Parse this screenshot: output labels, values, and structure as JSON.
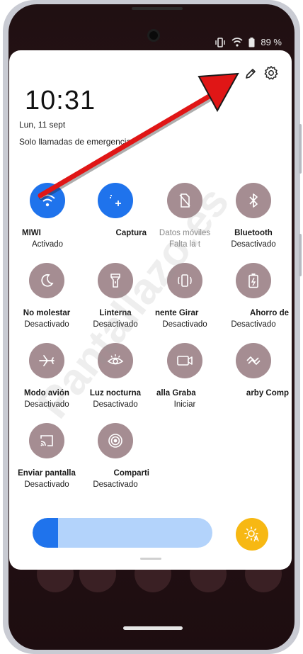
{
  "status_bar": {
    "battery": "89 %"
  },
  "panel": {
    "time": "10:31",
    "date": "Lun, 11 sept",
    "emergency_text": "Solo llamadas de emergencia"
  },
  "tiles": [
    {
      "label": "MIWI",
      "status": "Activado",
      "icon": "wifi-icon",
      "active": true
    },
    {
      "label": "Captura",
      "status": "",
      "icon": "screenshot-icon",
      "active": true
    },
    {
      "label": "Datos móviles",
      "status": "Falta la t",
      "icon": "mobile-data-icon",
      "active": false
    },
    {
      "label": "Bluetooth",
      "status": "Desactivado",
      "icon": "bluetooth-icon",
      "active": false
    },
    {
      "label": "No molestar",
      "status": "Desactivado",
      "icon": "moon-icon",
      "active": false
    },
    {
      "label": "Linterna",
      "status": "Desactivado",
      "icon": "flashlight-icon",
      "active": false
    },
    {
      "label": "nente Girar",
      "status": "Desactivado",
      "icon": "rotate-icon",
      "active": false
    },
    {
      "label": "Ahorro de",
      "status": "Desactivado",
      "icon": "battery-saver-icon",
      "active": false
    },
    {
      "label": "Modo avión",
      "status": "Desactivado",
      "icon": "airplane-icon",
      "active": false
    },
    {
      "label": "Luz nocturna",
      "status": "Desactivado",
      "icon": "eye-icon",
      "active": false
    },
    {
      "label": "alla Graba",
      "status": "Iniciar",
      "icon": "screen-record-icon",
      "active": false
    },
    {
      "label": "arby Comp",
      "status": "",
      "icon": "nearby-share-icon",
      "active": false
    },
    {
      "label": "Enviar pantalla",
      "status": "Desactivado",
      "icon": "cast-icon",
      "active": false
    },
    {
      "label": "Comparti",
      "status": "Desactivado",
      "icon": "hotspot-icon",
      "active": false
    }
  ],
  "brightness": {
    "level": 0.14
  },
  "watermark": "Pantallazo.es",
  "colors": {
    "active_tile": "#1f73ec",
    "inactive_tile": "#a58d92",
    "slider_track": "#b3d3fb",
    "auto_brightness": "#f7b813",
    "annotation_arrow": "#e01616"
  }
}
